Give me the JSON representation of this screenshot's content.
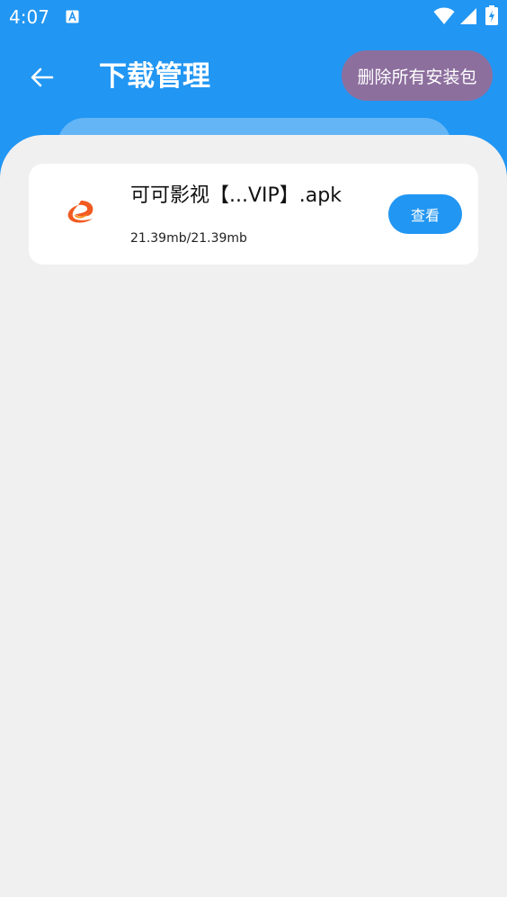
{
  "status_bar": {
    "time": "4:07",
    "notification_icon": "text-a-icon",
    "icons": [
      "wifi-icon",
      "signal-icon",
      "battery-charging-icon"
    ]
  },
  "header": {
    "back_icon": "arrow-left-icon",
    "title": "下载管理",
    "delete_all_label": "删除所有安装包"
  },
  "downloads": [
    {
      "icon": "app-logo-icon",
      "file_name": "可可影视【...VIP】.apk",
      "size": "21.39mb/21.39mb",
      "action_label": "查看"
    }
  ],
  "colors": {
    "primary": "#2196F3",
    "delete_button": "#8D6F9E",
    "background": "#F0F0F0",
    "logo": "#F15A22"
  }
}
